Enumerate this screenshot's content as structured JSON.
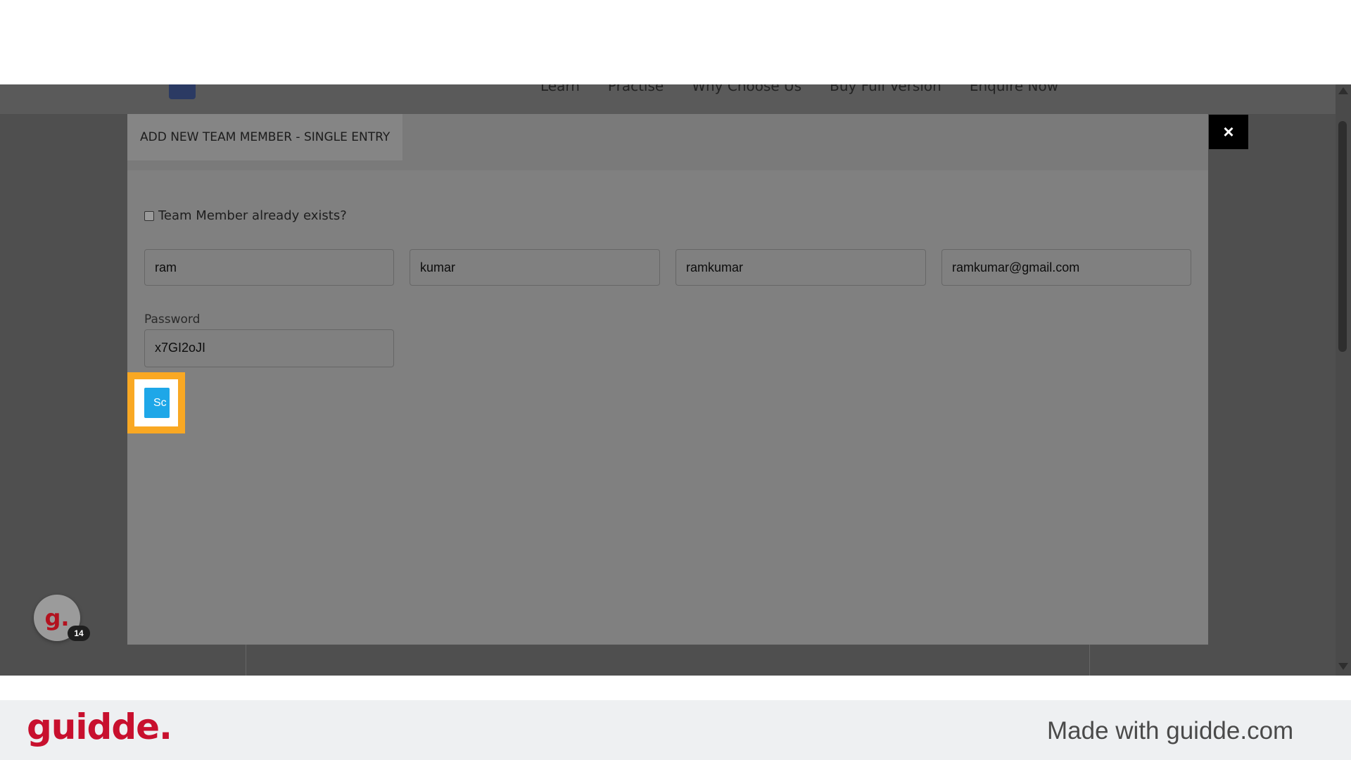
{
  "site": {
    "nav": [
      "Learn",
      "Practise",
      "Why Choose Us",
      "Buy Full Version",
      "Enquire Now"
    ]
  },
  "modal": {
    "title": "ADD NEW TEAM MEMBER - SINGLE ENTRY",
    "close_label": "×",
    "exists_label": "Team Member already exists?",
    "fields": {
      "first_name": "ram",
      "last_name": "kumar",
      "username": "ramkumar",
      "email": "ramkumar@gmail.com"
    },
    "password_label": "Password",
    "password_value": "x7GI2oJI",
    "submit_label": "Sc"
  },
  "avatar": {
    "letter": "g.",
    "badge": "14"
  },
  "footer": {
    "brand": "guidde.",
    "tagline": "Made with guidde.com"
  },
  "colors": {
    "highlight": "#f9a823",
    "submit": "#1ea7e8",
    "brand": "#c8102e"
  }
}
